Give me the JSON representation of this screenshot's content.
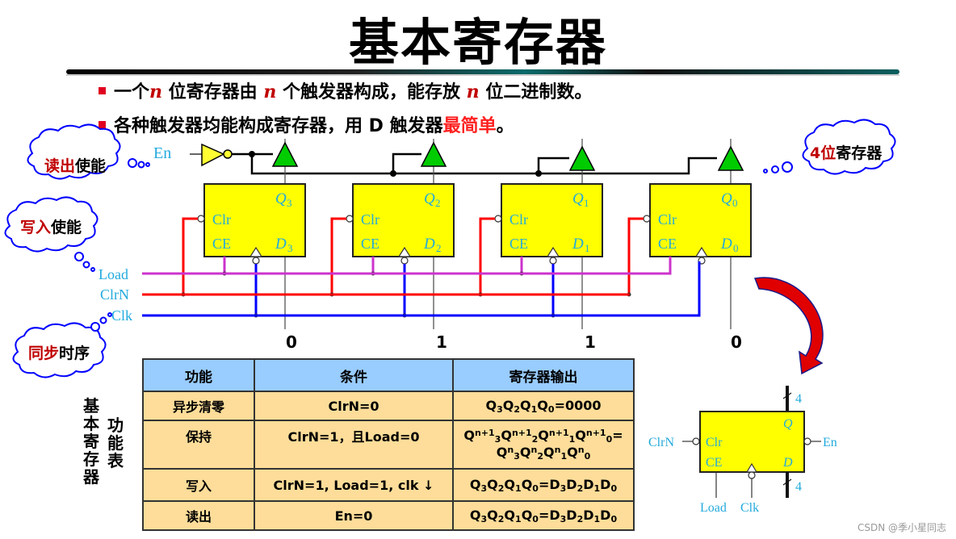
{
  "slide": {
    "title": "基本寄存器",
    "bullets": [
      {
        "parts": [
          "一个",
          "n",
          " 位寄存器由 ",
          "n",
          " 个触发器构成，能存放 ",
          "n",
          " 位二进制数。"
        ]
      },
      {
        "parts": [
          "各种触发器均能构成寄存器，用 D 触发器",
          "最简单",
          "。"
        ]
      }
    ]
  },
  "callouts": {
    "read_enable": {
      "red": "读出",
      "black": "使能"
    },
    "write_enable": {
      "red": "写入",
      "black": "使能"
    },
    "sync_timing": {
      "red": "同步",
      "black": "时序"
    },
    "four_bit": {
      "red": "4位",
      "black": "寄存器"
    }
  },
  "signals": {
    "en": "En",
    "load": "Load",
    "clrn": "ClrN",
    "clk": "Clk"
  },
  "flipflops": [
    {
      "q": "Q",
      "q_sub": "3",
      "d": "D",
      "d_sub": "3",
      "clr": "Clr",
      "ce": "CE",
      "value": "0"
    },
    {
      "q": "Q",
      "q_sub": "2",
      "d": "D",
      "d_sub": "2",
      "clr": "Clr",
      "ce": "CE",
      "value": "1"
    },
    {
      "q": "Q",
      "q_sub": "1",
      "d": "D",
      "d_sub": "1",
      "clr": "Clr",
      "ce": "CE",
      "value": "1"
    },
    {
      "q": "Q",
      "q_sub": "0",
      "d": "D",
      "d_sub": "0",
      "clr": "Clr",
      "ce": "CE",
      "value": "0"
    }
  ],
  "function_table": {
    "side_label_1": [
      "基",
      "本",
      "寄",
      "存",
      "器"
    ],
    "side_label_2": [
      "功",
      "能",
      "表"
    ],
    "headers": [
      "功能",
      "条件",
      "寄存器输出"
    ],
    "rows": [
      {
        "function": "异步清零",
        "condition": "ClrN=0",
        "output_html": "Q<sub>3</sub>Q<sub>2</sub>Q<sub>1</sub>Q<sub>0</sub>=0000"
      },
      {
        "function": "保持",
        "condition": "ClrN=1，且Load=0",
        "output_html": "Q<sup>n+1</sup><sub>3</sub>Q<sup>n+1</sup><sub>2</sub>Q<sup>n+1</sup><sub>1</sub>Q<sup>n+1</sup><sub>0</sub>=<br>Q<sup>n</sup><sub>3</sub>Q<sup>n</sup><sub>2</sub>Q<sup>n</sup><sub>1</sub>Q<sup>n</sup><sub>0</sub>"
      },
      {
        "function": "写入",
        "condition": "ClrN=1, Load=1, clk ↓",
        "output_html": "Q<sub>3</sub>Q<sub>2</sub>Q<sub>1</sub>Q<sub>0</sub>=D<sub>3</sub>D<sub>2</sub>D<sub>1</sub>D<sub>0</sub>"
      },
      {
        "function": "读出",
        "condition": "En=0",
        "output_html": "Q<sub>3</sub>Q<sub>2</sub>Q<sub>1</sub>Q<sub>0</sub>=D<sub>3</sub>D<sub>2</sub>D<sub>1</sub>D<sub>0</sub>"
      }
    ]
  },
  "symbol": {
    "q": "Q",
    "d": "D",
    "clr": "Clr",
    "ce": "CE",
    "clrn": "ClrN",
    "en": "En",
    "load": "Load",
    "clk": "Clk",
    "bus_width_top": "4",
    "bus_width_bottom": "4"
  },
  "watermark": "CSDN @季小星同志",
  "colors": {
    "ff_fill": "#ffff00",
    "buffer_fill": "#00cc00",
    "inverter_fill": "#ffff33",
    "load_wire": "#cc33cc",
    "clrn_wire": "#ff0000",
    "clk_wire": "#0000ff",
    "signal_text": "#22aadd",
    "table_header": "#99ccff",
    "table_body": "#fddd99",
    "cloud_stroke": "#0000ff",
    "arrow_fill": "#e00000"
  }
}
